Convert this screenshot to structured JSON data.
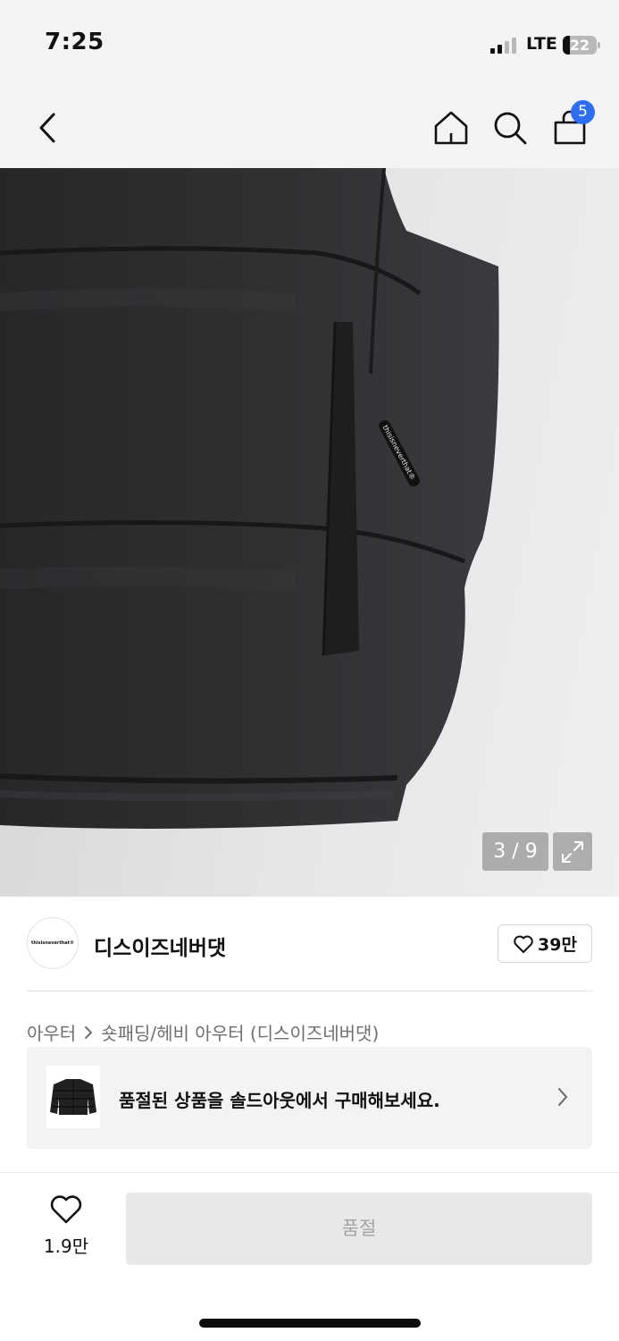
{
  "status_bar": {
    "time": "7:25",
    "network": "LTE",
    "battery": "22",
    "battery_level_percent": 22
  },
  "nav": {
    "back_icon": "chevron-left-icon",
    "home_icon": "home-icon",
    "search_icon": "search-icon",
    "cart_icon": "shopping-bag-icon",
    "cart_count": "5"
  },
  "gallery": {
    "counter": "3 / 9",
    "expand_icon": "expand-icon",
    "label_text": "thisisneverthat®"
  },
  "brand": {
    "logo_text": "thisisneverthat®",
    "name": "디스이즈네버댓",
    "like_count": "39만"
  },
  "breadcrumb": {
    "items": [
      "아우터",
      "숏패딩/헤비 아우터 (디스이즈네버댓)"
    ]
  },
  "soldout_banner": {
    "text": "품절된 상품을 솔드아웃에서 구매해보세요."
  },
  "bottom_bar": {
    "wish_count": "1.9만",
    "primary_button": "품절"
  },
  "colors": {
    "accent_blue": "#2e6ff2",
    "nav_bg": "#f4f4f4",
    "disabled_button": "#e8e8e8"
  }
}
